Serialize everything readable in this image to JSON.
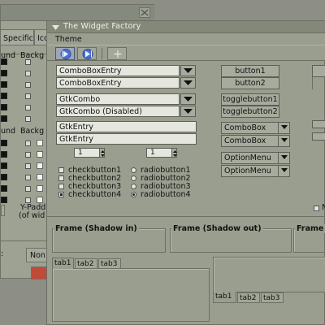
{
  "background_window": {
    "tabs": [
      "Specific",
      "Ico"
    ],
    "column_headers": [
      "und",
      "Backg",
      "und",
      "Backg"
    ],
    "y_padding_label": "Y-Padd",
    "y_padding_sub": "(of wid",
    "none_label": "Non"
  },
  "window": {
    "title": "The Widget Factory",
    "menu": [
      "Theme"
    ]
  },
  "combo_entries": [
    {
      "value": "ComboBoxEntry"
    },
    {
      "value": "ComboBoxEntry"
    }
  ],
  "gtk_combos": [
    {
      "value": "GtkCombo"
    },
    {
      "value": "GtkCombo (Disabled)"
    }
  ],
  "entries": [
    {
      "value": "GtkEntry"
    },
    {
      "value": "GtkEntry"
    }
  ],
  "spinbuttons": [
    {
      "value": "1"
    },
    {
      "value": "1"
    }
  ],
  "checkbuttons": [
    {
      "label": "checkbutton1",
      "checked": false
    },
    {
      "label": "checkbutton2",
      "checked": false
    },
    {
      "label": "checkbutton3",
      "checked": false
    },
    {
      "label": "checkbutton4",
      "checked": true
    }
  ],
  "radiobuttons": [
    {
      "label": "radiobutton1",
      "selected": false
    },
    {
      "label": "radiobutton2",
      "selected": false
    },
    {
      "label": "radiobutton3",
      "selected": false
    },
    {
      "label": "radiobutton4",
      "selected": true
    }
  ],
  "buttons": [
    "button1",
    "button2"
  ],
  "togglebuttons": [
    "togglebutton1",
    "togglebutton2"
  ],
  "comboboxes": [
    "ComboBox",
    "ComboBox"
  ],
  "option_menus": [
    "OptionMenu",
    "OptionMenu"
  ],
  "frames": {
    "shadow_in": "Frame (Shadow in)",
    "shadow_out": "Frame (Shadow out)",
    "third": "Frame"
  },
  "notebook_left_tabs": [
    "tab1",
    "tab2",
    "tab3"
  ],
  "notebook_right_tabs": [
    "tab1",
    "tab2",
    "tab3"
  ],
  "clipped_label": "N",
  "colors": {
    "background": "#8d8f86",
    "window_bg": "#9a9e8f",
    "titlebar": "#848879",
    "title_text": "#f0f2ea",
    "entry_bg": "#e5e7df",
    "toolbar_active": "#4a6fd0",
    "close_button": "#c24b38"
  },
  "icons": [
    "close-icon",
    "back-arrow-icon",
    "forward-arrow-icon",
    "add-icon",
    "dropdown-arrow-icon",
    "window-menu-icon"
  ]
}
